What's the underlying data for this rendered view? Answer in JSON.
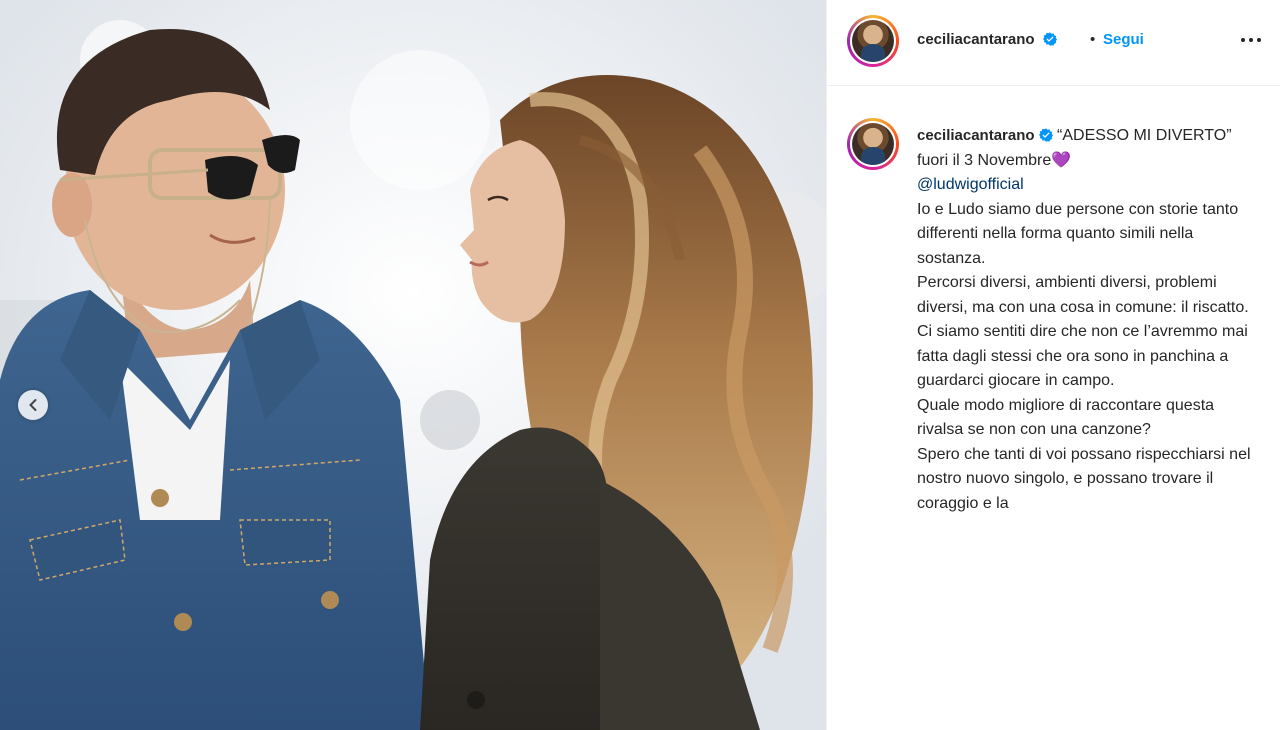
{
  "post": {
    "username": "ceciliacantarano",
    "follow_label": "Segui",
    "separator": "•",
    "caption_lead": "“ADESSO MI DIVERTO” fuori il 3 Novembre",
    "caption_emoji": "💜",
    "mention": "@ludwigofficial",
    "caption_lines": [
      "Io e Ludo siamo due persone con storie tanto differenti nella forma quanto simili nella sostanza.",
      "Percorsi diversi, ambienti diversi, problemi diversi, ma con una cosa in comune: il riscatto.",
      "Ci siamo sentiti dire che non ce l’avremmo mai fatta dagli stessi che ora sono in panchina a guardarci giocare in campo.",
      "Quale modo migliore di raccontare questa rivalsa se non con una canzone?",
      "Spero che tanti di voi possano rispecchiarsi nel nostro nuovo singolo, e possano trovare il coraggio e la"
    ]
  },
  "icons": {
    "verified": "verified-badge-icon",
    "more": "more-options-icon",
    "carousel_prev": "chevron-left-icon"
  },
  "colors": {
    "link_blue": "#0095f6",
    "verified_blue": "#0095f6",
    "mention": "#00376b",
    "text": "#262626"
  }
}
